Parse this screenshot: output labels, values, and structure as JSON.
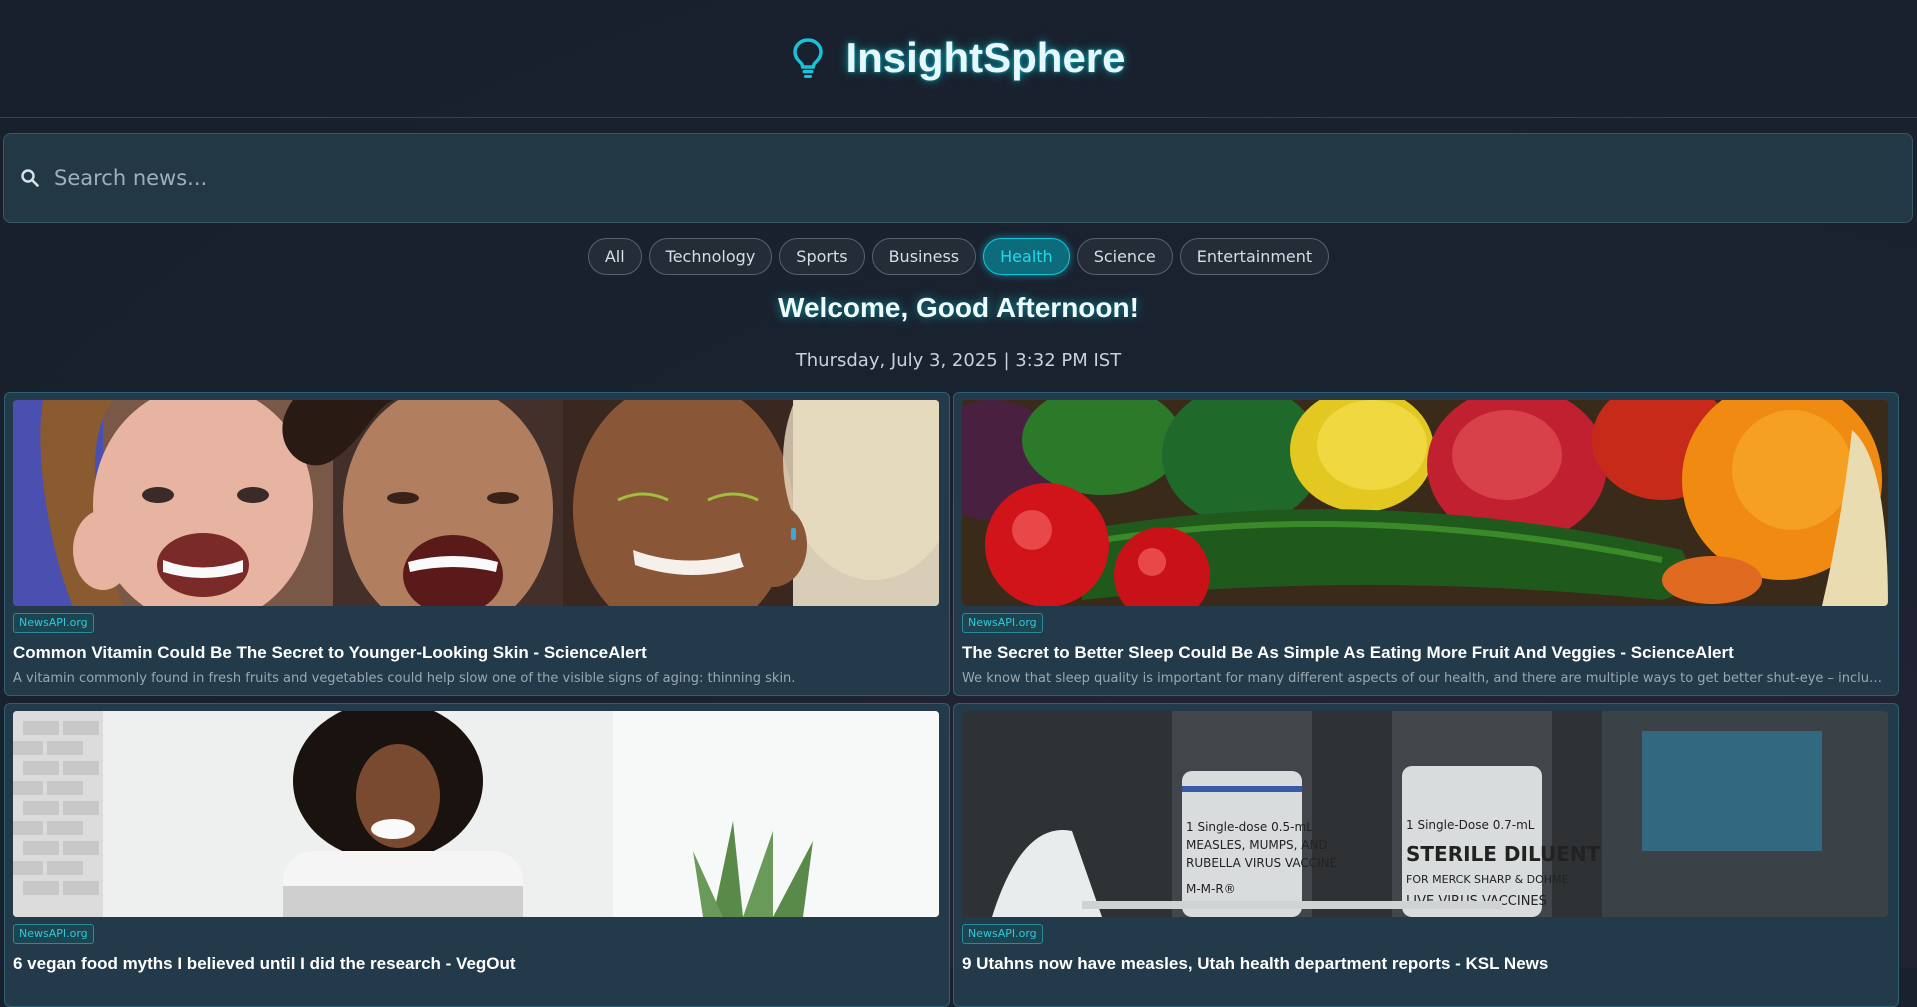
{
  "app": {
    "title": "InsightSphere",
    "icon": "lightbulb-icon",
    "accent_color": "#14c4d8"
  },
  "search": {
    "placeholder": "Search news...",
    "value": "",
    "icon": "search-icon"
  },
  "categories": [
    {
      "label": "All",
      "active": false
    },
    {
      "label": "Technology",
      "active": false
    },
    {
      "label": "Sports",
      "active": false
    },
    {
      "label": "Business",
      "active": false
    },
    {
      "label": "Health",
      "active": true
    },
    {
      "label": "Science",
      "active": false
    },
    {
      "label": "Entertainment",
      "active": false
    }
  ],
  "greeting": "Welcome, Good Afternoon!",
  "datetime": "Thursday, July 3, 2025 | 3:32 PM IST",
  "articles": [
    {
      "source": "NewsAPI.org",
      "title": "Common Vitamin Could Be The Secret to Younger-Looking Skin - ScienceAlert",
      "description": "A vitamin commonly found in fresh fruits and vegetables could help slow one of the visible signs of aging: thinning skin.",
      "image": "three-smiling-women-photo"
    },
    {
      "source": "NewsAPI.org",
      "title": "The Secret to Better Sleep Could Be As Simple As Eating More Fruit And Veggies - ScienceAlert",
      "description": "We know that sleep quality is important for many different aspects of our health, and there are multiple ways to get better shut-eye – including …",
      "image": "fruits-vegetables-photo"
    },
    {
      "source": "NewsAPI.org",
      "title": "6 vegan food myths I believed until I did the research - VegOut",
      "description": "",
      "image": "woman-at-laptop-photo"
    },
    {
      "source": "NewsAPI.org",
      "title": "9 Utahns now have measles, Utah health department reports - KSL News",
      "description": "",
      "image": "vaccine-vials-photo",
      "image_text": [
        "1 Single-dose 0.5-mL",
        "MEASLES, MUMPS, AND",
        "RUBELLA VIRUS VACCINE",
        "M-M-R®",
        "1 Single-Dose 0.7-mL",
        "STERILE DILUENT",
        "FOR MERCK SHARP & DOHME",
        "LIVE VIRUS VACCINES"
      ]
    }
  ]
}
